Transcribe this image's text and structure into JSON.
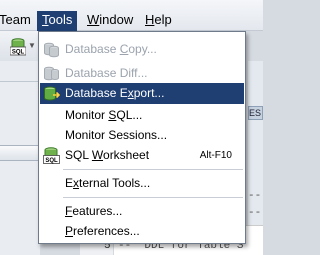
{
  "menubar": {
    "items": [
      {
        "label": "Team",
        "mnemonic": ""
      },
      {
        "label": "Tools",
        "mnemonic": "T"
      },
      {
        "label": "Window",
        "mnemonic": "W"
      },
      {
        "label": "Help",
        "mnemonic": "H"
      }
    ],
    "active": "Tools"
  },
  "toolbar": {
    "sql_icon": "database-sql-icon",
    "sql_badge": "SQL"
  },
  "tools_menu": {
    "items": [
      {
        "pre": "Database ",
        "ul": "C",
        "post": "opy...",
        "enabled": false,
        "icon": "database-copy-icon"
      },
      {
        "pre": "Database Diff",
        "ul": "",
        "post": "...",
        "enabled": false,
        "icon": "database-diff-icon"
      },
      {
        "pre": "Database E",
        "ul": "x",
        "post": "port...",
        "enabled": true,
        "highlighted": true,
        "icon": "database-export-icon"
      },
      {
        "pre": "Monitor ",
        "ul": "S",
        "post": "QL...",
        "enabled": true,
        "icon": ""
      },
      {
        "pre": "Monitor Sessions",
        "ul": "",
        "post": "...",
        "enabled": true,
        "icon": ""
      },
      {
        "pre": "SQL ",
        "ul": "W",
        "post": "orksheet",
        "enabled": true,
        "icon": "sql-worksheet-icon",
        "accelerator": "Alt-F10"
      },
      {
        "pre": "E",
        "ul": "x",
        "post": "ternal Tools...",
        "enabled": true,
        "icon": ""
      },
      {
        "pre": "",
        "ul": "F",
        "post": "eatures...",
        "enabled": true,
        "icon": ""
      },
      {
        "pre": "",
        "ul": "P",
        "post": "references...",
        "enabled": true,
        "icon": ""
      }
    ],
    "sql_badge": "SQL"
  },
  "editor": {
    "line_number": "5",
    "line_text": "--  DDL for Table S",
    "partial_line_above": "-- ",
    "right_tab_label": "ES",
    "dash_fragment": "--"
  },
  "colors": {
    "menu_highlight": "#1f3f73",
    "disabled_text": "#9ba3ad",
    "menu_border": "#6f7b8a"
  }
}
